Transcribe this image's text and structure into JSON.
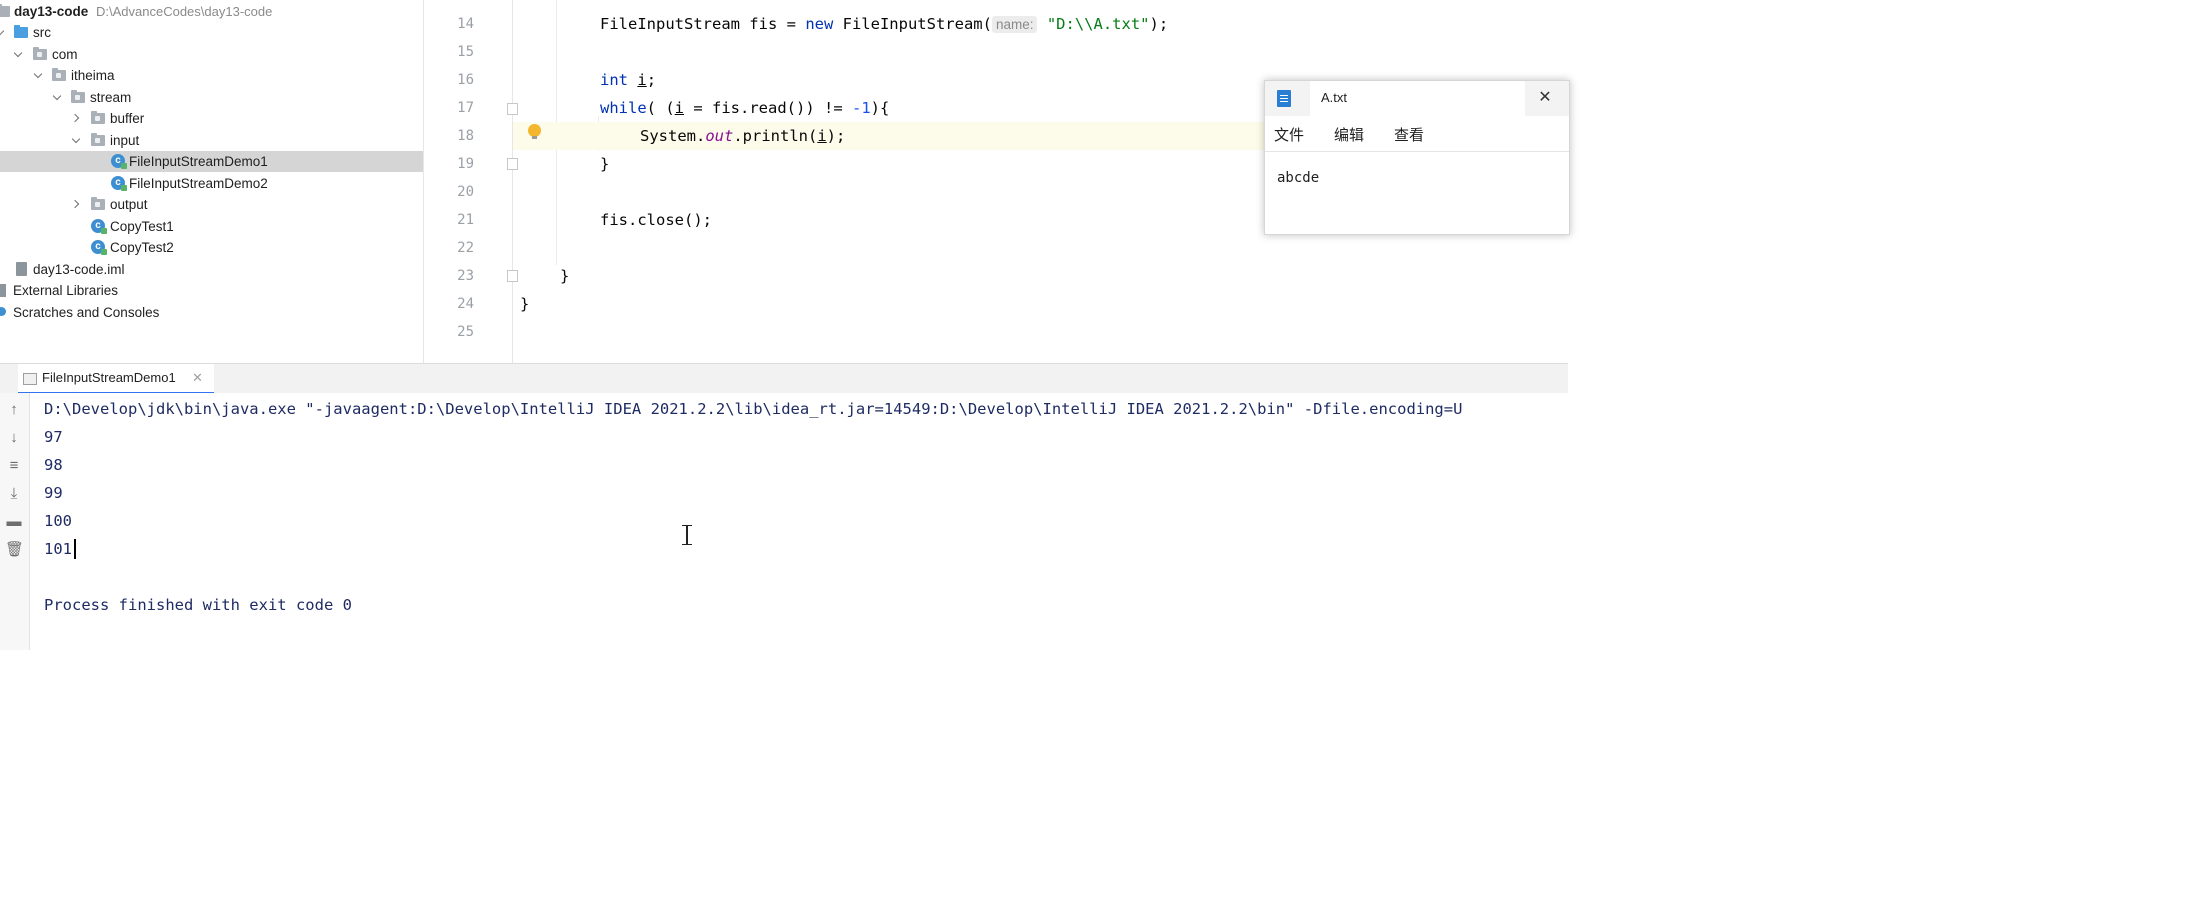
{
  "project_tree": {
    "root_name": "day13-code",
    "root_path": "D:\\AdvanceCodes\\day13-code",
    "items": [
      {
        "label": "src"
      },
      {
        "label": "com"
      },
      {
        "label": "itheima"
      },
      {
        "label": "stream"
      },
      {
        "label": "buffer"
      },
      {
        "label": "input"
      },
      {
        "label": "FileInputStreamDemo1"
      },
      {
        "label": "FileInputStreamDemo2"
      },
      {
        "label": "output"
      },
      {
        "label": "CopyTest1"
      },
      {
        "label": "CopyTest2"
      },
      {
        "label": "day13-code.iml"
      },
      {
        "label": "External Libraries"
      },
      {
        "label": "Scratches and Consoles"
      }
    ]
  },
  "editor": {
    "line_numbers": [
      "14",
      "15",
      "16",
      "17",
      "18",
      "19",
      "20",
      "21",
      "22",
      "23",
      "24",
      "25"
    ],
    "lines": {
      "l14_type": "FileInputStream fis = ",
      "l14_new": "new",
      "l14_ctor": " FileInputStream(",
      "l14_hint": "name:",
      "l14_str": "\"D:\\\\A.txt\"",
      "l14_end": ");",
      "l16_kw": "int",
      "l16_var": "i",
      "l16_end": ";",
      "l17_kw": "while",
      "l17_a": "( (",
      "l17_var": "i",
      "l17_b": " = fis.read()) != ",
      "l17_num": "-1",
      "l17_c": "){",
      "l18_a": "System.",
      "l18_field": "out",
      "l18_b": ".println(",
      "l18_var": "i",
      "l18_c": ");",
      "l19": "}",
      "l21": "fis.close();",
      "l23": "}",
      "l24": "}"
    }
  },
  "notepad": {
    "tab_title": "A.txt",
    "menu": [
      "文件",
      "编辑",
      "查看"
    ],
    "content": "abcde"
  },
  "run_panel": {
    "tab_label": "FileInputStreamDemo1",
    "command": "D:\\Develop\\jdk\\bin\\java.exe \"-javaagent:D:\\Develop\\IntelliJ IDEA 2021.2.2\\lib\\idea_rt.jar=14549:D:\\Develop\\IntelliJ IDEA 2021.2.2\\bin\" -Dfile.encoding=U",
    "output": [
      "97",
      "98",
      "99",
      "100",
      "101"
    ],
    "exit_message": "Process finished with exit code 0"
  }
}
